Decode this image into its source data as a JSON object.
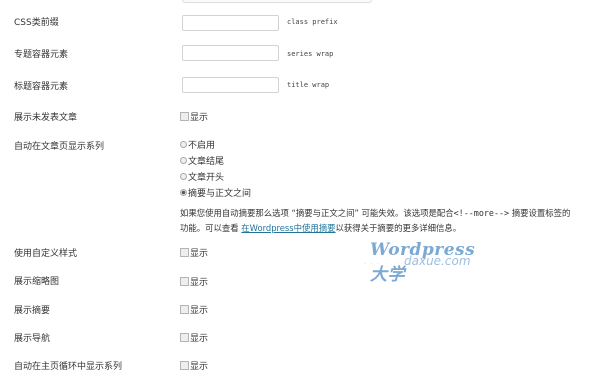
{
  "settings": {
    "css_prefix": {
      "label": "CSS类前缀",
      "value": "",
      "hint": "class prefix"
    },
    "list_container": {
      "label": "专题容器元素",
      "value": "",
      "hint": "series wrap"
    },
    "title_container": {
      "label": "标题容器元素",
      "value": "",
      "hint": "title wrap"
    },
    "show_unpublished": {
      "label": "展示未发表文章",
      "option": "显示"
    },
    "auto_show": {
      "label": "自动在文章页显示系列",
      "options": [
        "不启用",
        "文章结尾",
        "文章开头",
        "摘要与正文之间"
      ],
      "selected": "摘要与正文之间"
    },
    "description": {
      "line1": "如果您使用自动摘要那么选项 “摘要与正文之间” 可能失效。该选项是配合",
      "more_tag": "<!--more-->",
      "line1_end": " 摘要设置标签的",
      "line2": "功能。可以查看",
      "link_text": "在Wordpress中使用摘要",
      "line2_end": "以获得关于摘要的更多详细信息。"
    },
    "custom_style": {
      "label": "使用自定义样式",
      "option": "显示"
    },
    "show_thumbnail": {
      "label": "展示缩略图",
      "option": "显示"
    },
    "show_excerpt": {
      "label": "展示摘要",
      "option": "显示"
    },
    "show_nav": {
      "label": "展示导航",
      "option": "显示"
    },
    "show_on_home": {
      "label": "自动在主页循环中显示系列",
      "option": "显示"
    }
  },
  "watermark": {
    "line1": "Wordpress大学",
    "line2": "daxue.com"
  }
}
